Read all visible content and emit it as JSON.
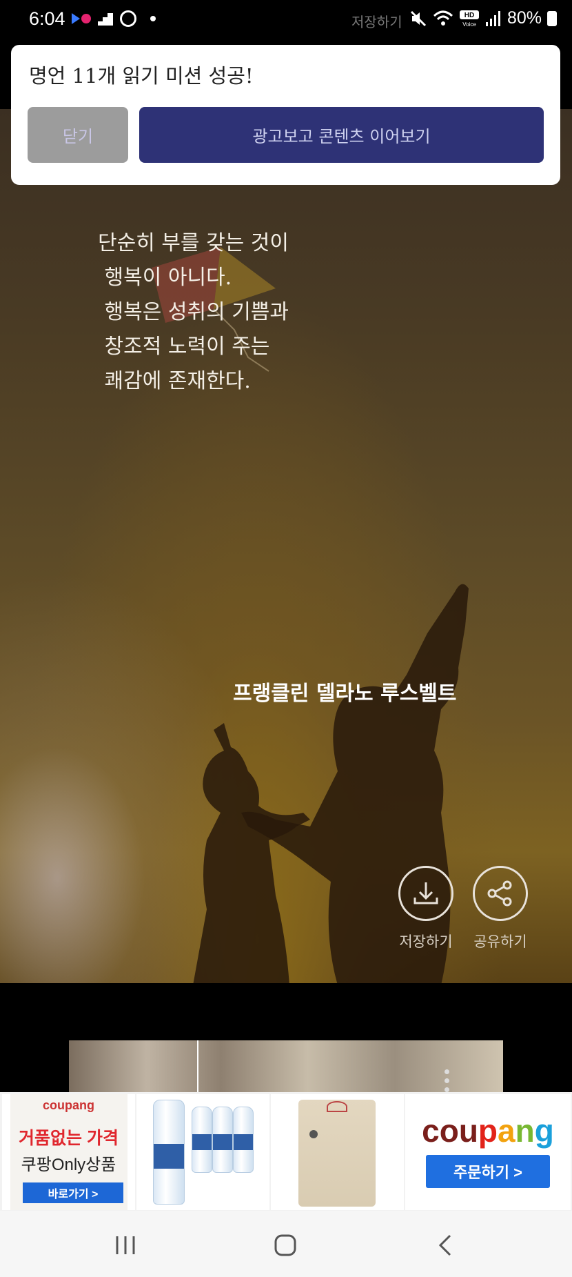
{
  "status_bar": {
    "time": "6:04",
    "ghost_text": "저장하기",
    "battery": "80%",
    "icons": [
      "media-icon",
      "stairs-icon",
      "gauge-icon",
      "dot-icon",
      "mute-icon",
      "wifi-icon",
      "hd-voice-icon",
      "signal-icon",
      "battery-icon"
    ]
  },
  "popup": {
    "message": "명언 11개 읽기 미션 성공!",
    "close_label": "닫기",
    "ad_label": "광고보고 콘텐츠 이어보기"
  },
  "quote": {
    "lines": [
      "단순히 부를 갖는 것이",
      " 행복이 아니다.",
      " 행복은 성취의 기쁨과",
      " 창조적 노력이 주는",
      " 쾌감에 존재한다."
    ],
    "author": "프랭클린 델라노 루스벨트"
  },
  "actions": {
    "save_label": "저장하기",
    "share_label": "공유하기"
  },
  "ad_banner": {
    "coupang_small_logo": "coupang",
    "headline": "거품없는 가격",
    "subline": "쿠팡Only상품",
    "go_button": "바로가기 >",
    "coupang_logo": [
      "cou",
      "p",
      "a",
      "n",
      "g"
    ],
    "order_button": "주문하기 >"
  },
  "nav": {
    "icons": [
      "recent-apps-icon",
      "home-icon",
      "back-icon"
    ]
  }
}
